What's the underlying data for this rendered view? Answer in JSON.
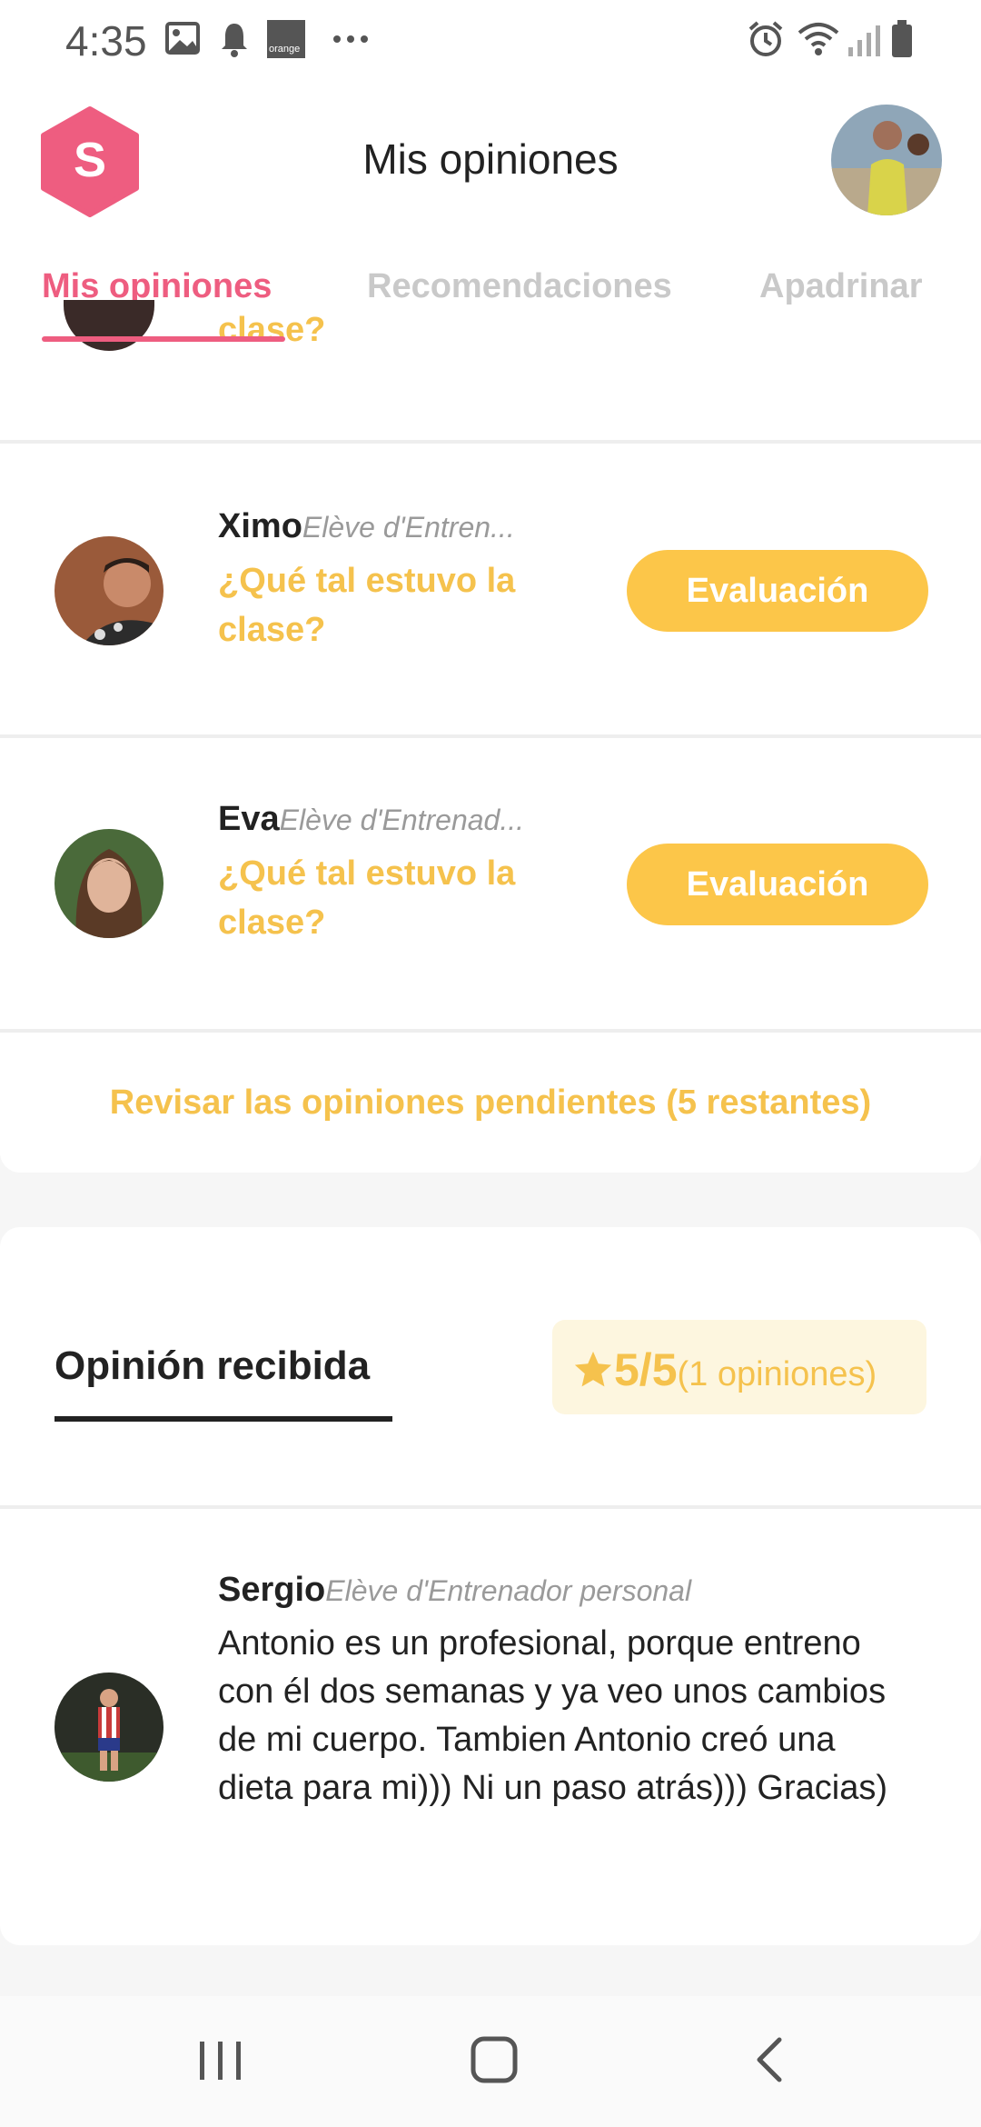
{
  "status_bar": {
    "time": "4:35",
    "left_icons": [
      "image-icon",
      "bell-icon",
      "orange-carrier-icon",
      "more-dots-icon"
    ],
    "carrier_label": "orange",
    "right_icons": [
      "alarm-icon",
      "wifi-icon",
      "signal-icon",
      "battery-icon"
    ]
  },
  "header": {
    "logo_letter": "S",
    "title": "Mis opiniones"
  },
  "tabs": [
    {
      "label": "Mis opiniones",
      "active": true
    },
    {
      "label": "Recomendaciones",
      "active": false
    },
    {
      "label": "Apadrinar",
      "active": false
    }
  ],
  "pending": {
    "clipped_text": "clase?",
    "items": [
      {
        "name": "Ximo",
        "role": "Elève d'Entren...",
        "question": "¿Qué tal estuvo la clase?",
        "button": "Evaluación"
      },
      {
        "name": "Eva",
        "role": "Elève d'Entrenad...",
        "question": "¿Qué tal estuvo la clase?",
        "button": "Evaluación"
      }
    ],
    "review_link": "Revisar las opiniones pendientes (5 restantes)"
  },
  "received": {
    "title": "Opinión recibida",
    "rating": "5/5",
    "rating_count": "(1 opiniones)",
    "review": {
      "name": "Sergio",
      "role": "Elève d'Entrenador personal",
      "text": "Antonio es un profesional, porque entreno con él dos semanas y ya veo unos cambios de mi cuerpo. Tambien Antonio creó una dieta para mi))) Ni un paso atrás))) Gracias)"
    }
  },
  "colors": {
    "brand_pink": "#ee5d80",
    "accent_yellow": "#fcc649",
    "text_dark": "#222222"
  }
}
